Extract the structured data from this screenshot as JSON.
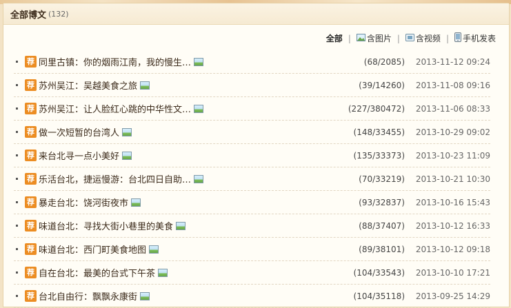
{
  "header": {
    "title": "全部博文",
    "count": "(132)"
  },
  "filters": {
    "all": "全部",
    "with_images": "含图片",
    "with_video": "含视频",
    "mobile_post": "手机发表"
  },
  "posts": [
    {
      "badge": "荐",
      "title": "同里古镇：你的烟雨江南，我的慢生…",
      "stats": "(68/2085)",
      "date": "2013-11-12 09:24"
    },
    {
      "badge": "荐",
      "title": "苏州吴江：吴越美食之旅",
      "stats": "(39/14260)",
      "date": "2013-11-08 09:16"
    },
    {
      "badge": "荐",
      "title": "苏州吴江：让人脸红心跳的中华性文…",
      "stats": "(227/380472)",
      "date": "2013-11-06 08:33"
    },
    {
      "badge": "荐",
      "title": "做一次短暂的台湾人",
      "stats": "(148/33455)",
      "date": "2013-10-29 09:02"
    },
    {
      "badge": "荐",
      "title": "来台北寻一点小美好",
      "stats": "(135/33373)",
      "date": "2013-10-23 11:09"
    },
    {
      "badge": "荐",
      "title": "乐活台北，捷运慢游：台北四日自助…",
      "stats": "(70/33219)",
      "date": "2013-10-21 10:30"
    },
    {
      "badge": "荐",
      "title": "暴走台北：饶河街夜市",
      "stats": "(93/32837)",
      "date": "2013-10-16 15:43"
    },
    {
      "badge": "荐",
      "title": "味道台北：寻找大街小巷里的美食",
      "stats": "(88/37407)",
      "date": "2013-10-12 16:33"
    },
    {
      "badge": "荐",
      "title": "味道台北：西门町美食地图",
      "stats": "(89/38101)",
      "date": "2013-10-12 09:18"
    },
    {
      "badge": "荐",
      "title": "自在台北：最美的台式下午茶",
      "stats": "(104/33543)",
      "date": "2013-10-10 17:21"
    },
    {
      "badge": "荐",
      "title": "台北自由行：飘飘永康街",
      "stats": "(104/35118)",
      "date": "2013-09-25 14:29"
    }
  ]
}
